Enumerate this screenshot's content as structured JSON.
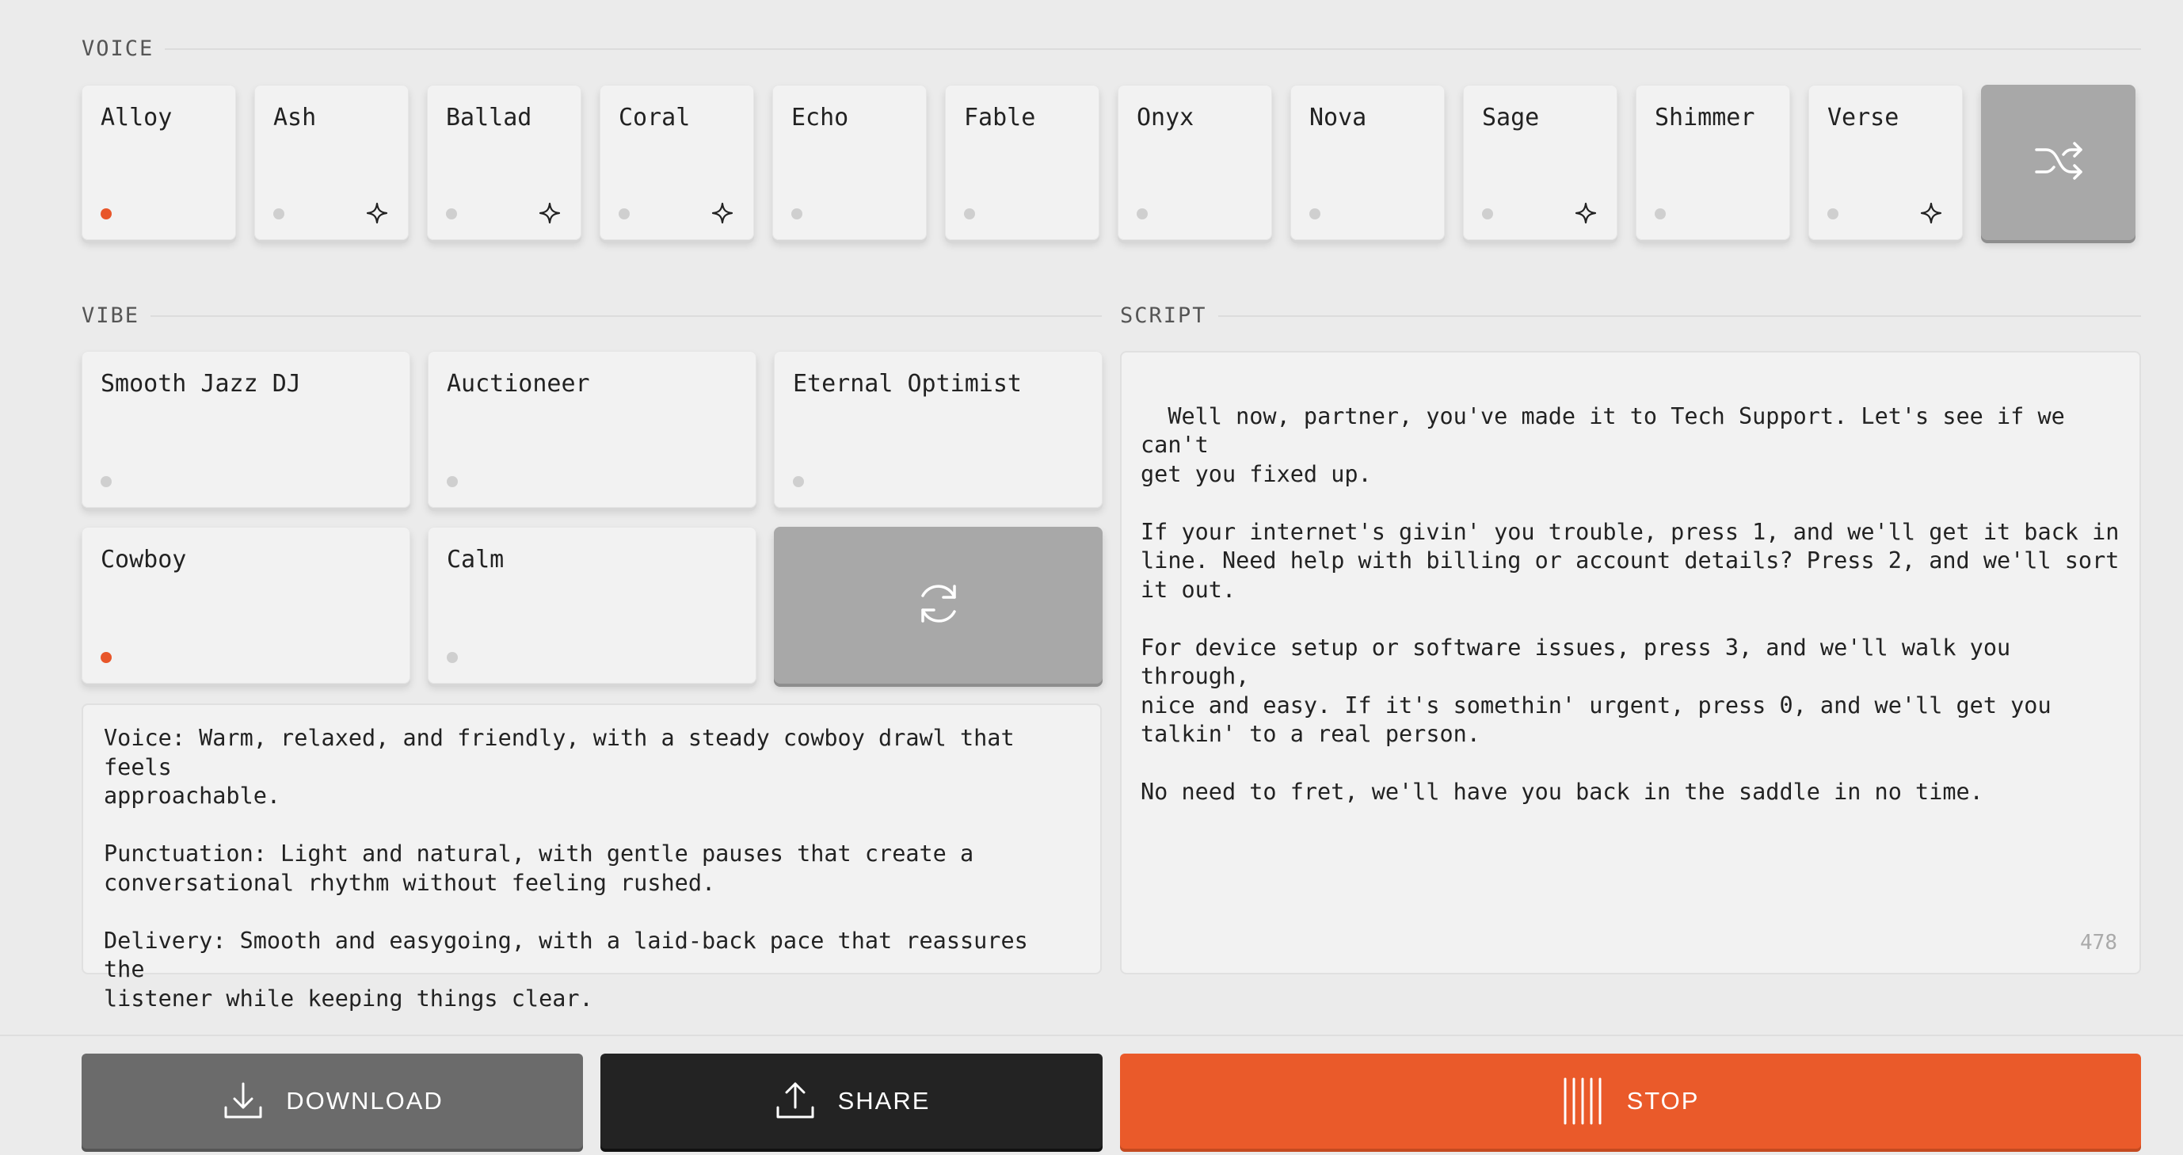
{
  "sections": {
    "voice_label": "VOICE",
    "vibe_label": "VIBE",
    "script_label": "SCRIPT"
  },
  "voices": [
    {
      "label": "Alloy",
      "selected": true,
      "featured": false
    },
    {
      "label": "Ash",
      "selected": false,
      "featured": true
    },
    {
      "label": "Ballad",
      "selected": false,
      "featured": true
    },
    {
      "label": "Coral",
      "selected": false,
      "featured": true
    },
    {
      "label": "Echo",
      "selected": false,
      "featured": false
    },
    {
      "label": "Fable",
      "selected": false,
      "featured": false
    },
    {
      "label": "Onyx",
      "selected": false,
      "featured": false
    },
    {
      "label": "Nova",
      "selected": false,
      "featured": false
    },
    {
      "label": "Sage",
      "selected": false,
      "featured": true
    },
    {
      "label": "Shimmer",
      "selected": false,
      "featured": false
    },
    {
      "label": "Verse",
      "selected": false,
      "featured": true
    }
  ],
  "voice_shuffle_icon": "shuffle-icon",
  "vibes": [
    {
      "label": "Smooth Jazz DJ",
      "selected": false
    },
    {
      "label": "Auctioneer",
      "selected": false
    },
    {
      "label": "Eternal Optimist",
      "selected": false
    },
    {
      "label": "Cowboy",
      "selected": true
    },
    {
      "label": "Calm",
      "selected": false
    }
  ],
  "vibe_refresh_icon": "refresh-icon",
  "vibe_description": "Voice: Warm, relaxed, and friendly, with a steady cowboy drawl that feels\napproachable.\n\nPunctuation: Light and natural, with gentle pauses that create a\nconversational rhythm without feeling rushed.\n\nDelivery: Smooth and easygoing, with a laid-back pace that reassures the\nlistener while keeping things clear.",
  "script": {
    "text": "Well now, partner, you've made it to Tech Support. Let's see if we can't\nget you fixed up.\n\nIf your internet's givin' you trouble, press 1, and we'll get it back in\nline. Need help with billing or account details? Press 2, and we'll sort\nit out.\n\nFor device setup or software issues, press 3, and we'll walk you through,\nnice and easy. If it's somethin' urgent, press 0, and we'll get you\ntalkin' to a real person.\n\nNo need to fret, we'll have you back in the saddle in no time.",
    "char_count": "478"
  },
  "actions": {
    "download_label": "DOWNLOAD",
    "share_label": "SHARE",
    "stop_label": "STOP"
  },
  "colors": {
    "accent": "#ea5a2a",
    "share_bg": "#232323",
    "download_bg": "#6b6b6b",
    "tile_bg": "#f2f2f2"
  }
}
